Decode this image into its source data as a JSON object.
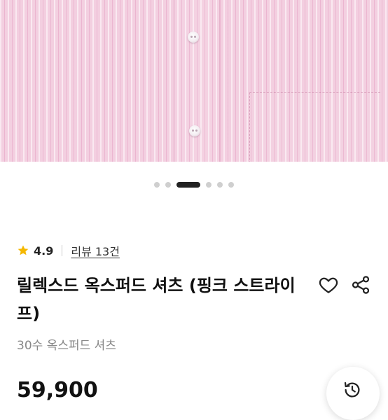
{
  "carousel": {
    "dot_count": 6,
    "active_index": 2
  },
  "rating": {
    "value": "4.9",
    "reviews_label": "리뷰 13건",
    "star_color": "#f5b800"
  },
  "product": {
    "title": "릴렉스드 옥스퍼드 셔츠 (핑크 스트라이프)",
    "subtitle": "30수 옥스퍼드 셔츠",
    "price": "59,900"
  },
  "icons": {
    "like": "heart-icon",
    "share": "share-icon",
    "history": "history-icon"
  }
}
